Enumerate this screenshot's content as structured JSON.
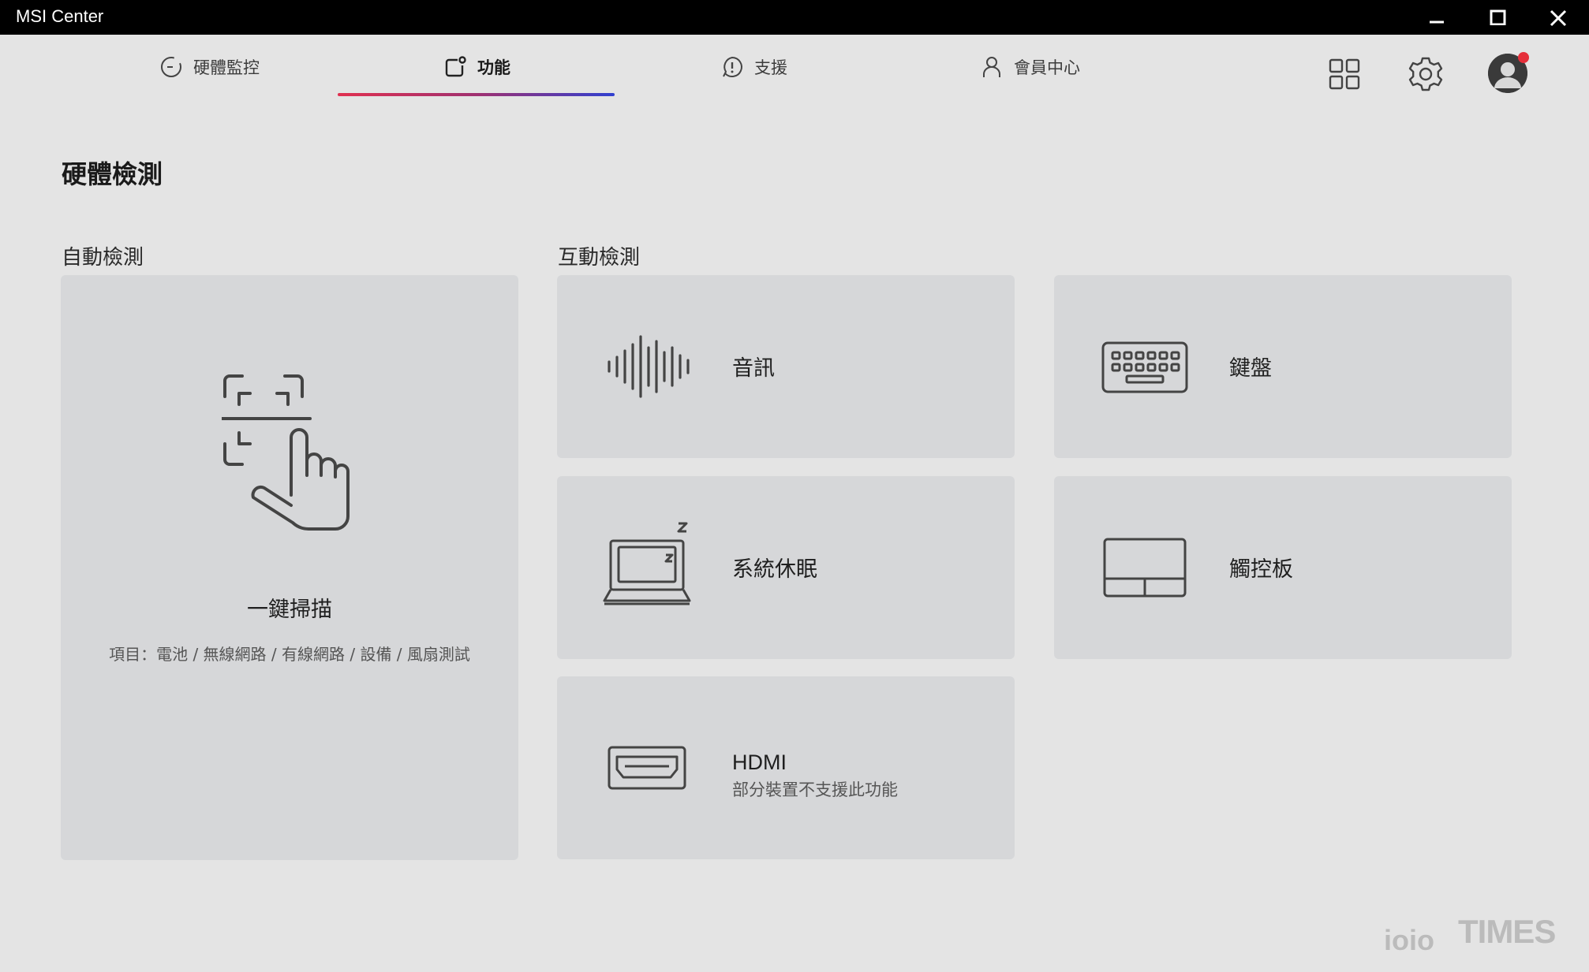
{
  "window": {
    "title": "MSI Center"
  },
  "nav": {
    "tabs": [
      {
        "label": "硬體監控",
        "icon": "gauge-icon"
      },
      {
        "label": "功能",
        "icon": "feature-icon",
        "active": true
      },
      {
        "label": "支援",
        "icon": "support-icon"
      },
      {
        "label": "會員中心",
        "icon": "user-icon"
      }
    ],
    "right_icons": [
      "apps-grid-icon",
      "settings-gear-icon",
      "avatar"
    ],
    "accent_gradient": [
      "#e03050",
      "#3040d0"
    ],
    "notification_color": "#e52f3a"
  },
  "page": {
    "title": "硬體檢測",
    "auto_section": "自動檢測",
    "interactive_section": "互動檢測"
  },
  "scan_card": {
    "label": "一鍵掃描",
    "description": "項目：電池 / 無線網路 / 有線網路 / 設備 / 風扇測試",
    "icon": "touch-scan-icon"
  },
  "cards": {
    "audio": {
      "label": "音訊",
      "icon": "waveform-icon"
    },
    "keyboard": {
      "label": "鍵盤",
      "icon": "keyboard-icon"
    },
    "sleep": {
      "label": "系統休眠",
      "icon": "laptop-sleep-icon"
    },
    "touchpad": {
      "label": "觸控板",
      "icon": "touchpad-icon"
    },
    "hdmi": {
      "label": "HDMI",
      "sublabel": "部分裝置不支援此功能",
      "icon": "hdmi-port-icon"
    }
  },
  "watermark": {
    "text": "TIMES",
    "logo": "ioio"
  }
}
